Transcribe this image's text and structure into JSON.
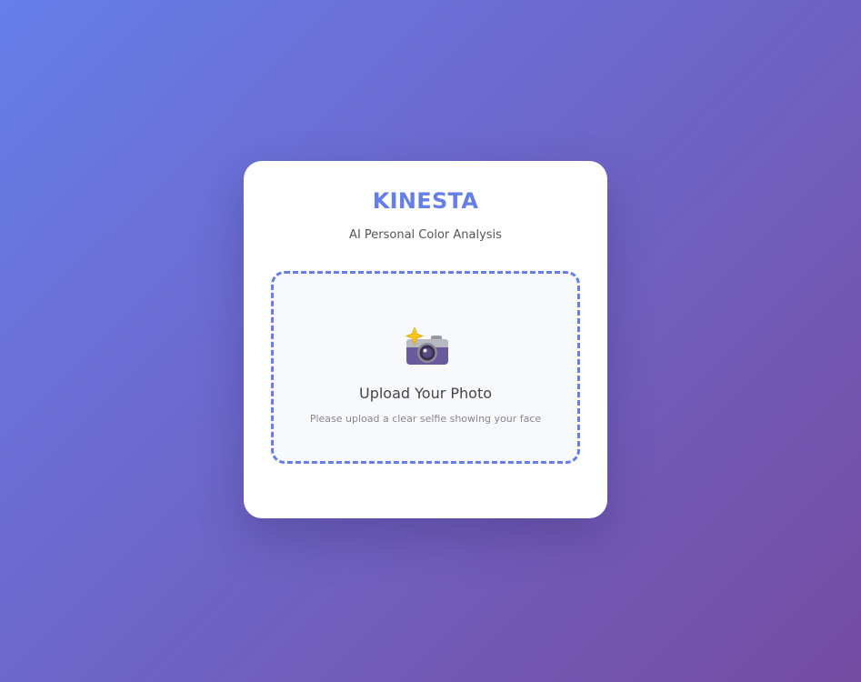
{
  "app": {
    "brand": "KINESTA",
    "subtitle": "AI Personal Color Analysis"
  },
  "upload": {
    "icon": "camera-flash-icon",
    "title": "Upload Your Photo",
    "hint": "Please upload a clear selfie showing your face"
  },
  "colors": {
    "accent": "#667eea",
    "gradient_start": "#667eea",
    "gradient_end": "#764ba2",
    "card_background": "#ffffff",
    "dropzone_background": "#f8f9fd"
  }
}
